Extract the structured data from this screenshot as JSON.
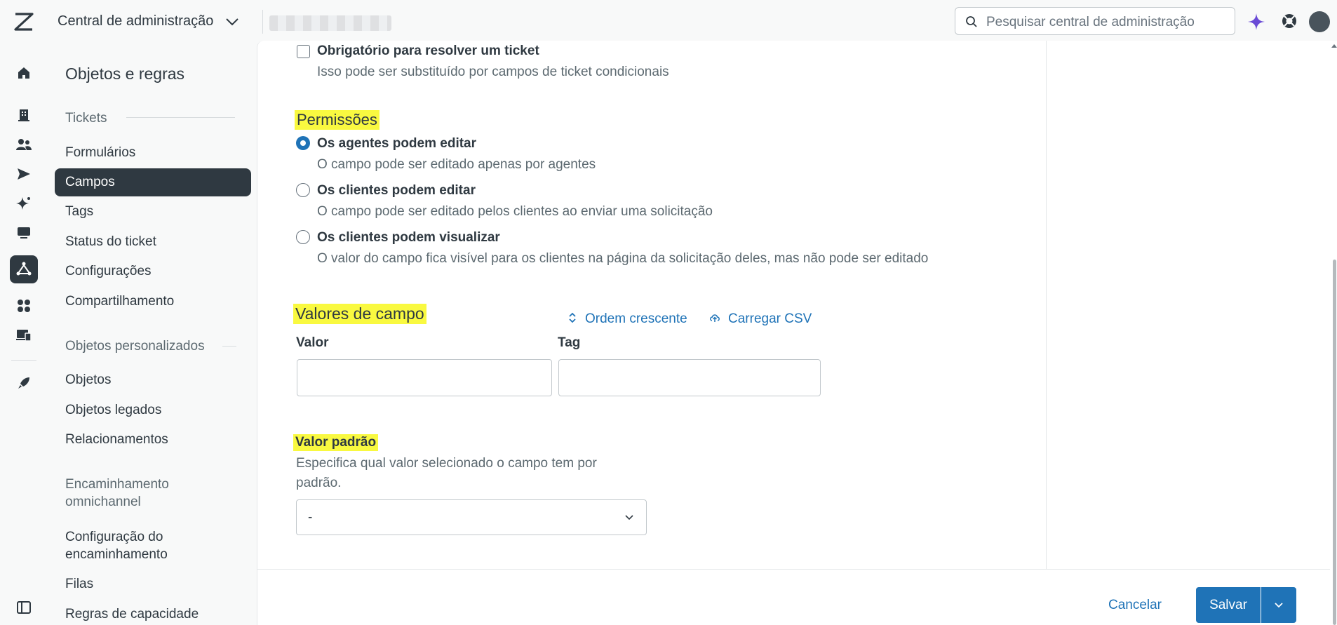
{
  "topbar": {
    "app_title": "Central de administração",
    "search_placeholder": "Pesquisar central de administração"
  },
  "subnav": {
    "title": "Objetos e regras",
    "sections": [
      {
        "label": "Tickets"
      },
      {
        "label": "Objetos personalizados"
      },
      {
        "label": "Encaminhamento omnichannel"
      }
    ],
    "items": [
      {
        "label": "Formulários"
      },
      {
        "label": "Campos"
      },
      {
        "label": "Tags"
      },
      {
        "label": "Status do ticket"
      },
      {
        "label": "Configurações"
      },
      {
        "label": "Compartilhamento"
      },
      {
        "label": "Objetos"
      },
      {
        "label": "Objetos legados"
      },
      {
        "label": "Relacionamentos"
      },
      {
        "label": "Configuração do encaminhamento"
      },
      {
        "label": "Filas"
      },
      {
        "label": "Regras de capacidade"
      }
    ],
    "active_item": "Campos"
  },
  "form": {
    "required_checkbox": {
      "label": "Obrigatório para resolver um ticket",
      "description": "Isso pode ser substituído por campos de ticket condicionais",
      "checked": false
    },
    "permissions": {
      "heading": "Permissões",
      "options": [
        {
          "label": "Os agentes podem editar",
          "description": "O campo pode ser editado apenas por agentes",
          "selected": true
        },
        {
          "label": "Os clientes podem editar",
          "description": "O campo pode ser editado pelos clientes ao enviar uma solicitação",
          "selected": false
        },
        {
          "label": "Os clientes podem visualizar",
          "description": "O valor do campo fica visível para os clientes na página da solicitação deles, mas não pode ser editado",
          "selected": false
        }
      ]
    },
    "field_values": {
      "heading": "Valores de campo",
      "sort_link": "Ordem crescente",
      "upload_link": "Carregar CSV",
      "value_column": "Valor",
      "tag_column": "Tag",
      "value_input": "",
      "tag_input": ""
    },
    "default_value": {
      "heading": "Valor padrão",
      "description_line1": "Especifica qual valor selecionado o campo tem por",
      "description_line2": "padrão.",
      "selected": "-"
    }
  },
  "footer": {
    "cancel_label": "Cancelar",
    "save_label": "Salvar"
  },
  "colors": {
    "accent": "#1f73b7",
    "highlight": "#f9f940",
    "dark": "#2f3941"
  }
}
